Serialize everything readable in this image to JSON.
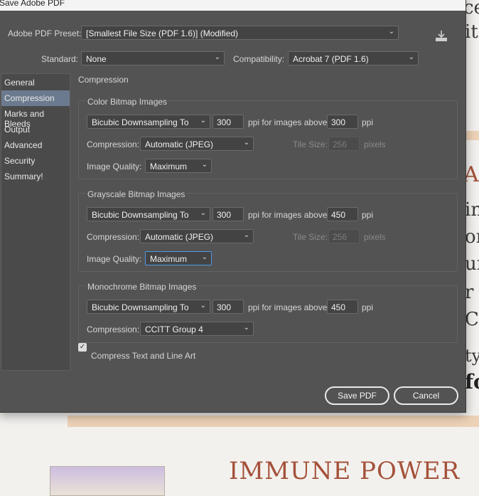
{
  "window": {
    "title": "Save Adobe PDF"
  },
  "preset": {
    "label": "Adobe PDF Preset:",
    "value": "[Smallest File Size (PDF 1.6)] (Modified)"
  },
  "standard": {
    "label": "Standard:",
    "value": "None"
  },
  "compatibility": {
    "label": "Compatibility:",
    "value": "Acrobat 7 (PDF 1.6)"
  },
  "sidebar": {
    "items": [
      {
        "label": "General"
      },
      {
        "label": "Compression"
      },
      {
        "label": "Marks and Bleeds"
      },
      {
        "label": "Output"
      },
      {
        "label": "Advanced"
      },
      {
        "label": "Security"
      },
      {
        "label": "Summary!"
      }
    ],
    "active_index": 1
  },
  "main": {
    "title": "Compression",
    "color": {
      "title": "Color Bitmap Images",
      "downsample": "Bicubic Downsampling To",
      "ppi": "300",
      "above_label": "ppi for images above",
      "above_value": "300",
      "ppi_unit": "ppi",
      "compression_label": "Compression:",
      "compression": "Automatic (JPEG)",
      "tile_label": "Tile Size:",
      "tile_value": "256",
      "tile_unit": "pixels",
      "quality_label": "Image Quality:",
      "quality": "Maximum"
    },
    "grayscale": {
      "title": "Grayscale Bitmap Images",
      "downsample": "Bicubic Downsampling To",
      "ppi": "300",
      "above_label": "ppi for images above",
      "above_value": "450",
      "ppi_unit": "ppi",
      "compression_label": "Compression:",
      "compression": "Automatic (JPEG)",
      "tile_label": "Tile Size:",
      "tile_value": "256",
      "tile_unit": "pixels",
      "quality_label": "Image Quality:",
      "quality": "Maximum"
    },
    "mono": {
      "title": "Monochrome Bitmap Images",
      "downsample": "Bicubic Downsampling To",
      "ppi": "300",
      "above_label": "ppi for images above",
      "above_value": "450",
      "ppi_unit": "ppi",
      "compression_label": "Compression:",
      "compression": "CCITT Group 4"
    },
    "compress_text": {
      "label": "Compress Text and Line Art",
      "checked": true
    }
  },
  "buttons": {
    "save": "Save PDF",
    "cancel": "Cancel"
  },
  "background_doc": {
    "frag_1": "ce",
    "frag_2": "it",
    "frag_3": "A",
    "frag_4": "in",
    "frag_5": "on",
    "frag_6": "ur",
    "frag_7": "r",
    "frag_8": "C",
    "frag_9": "ty",
    "frag_10": "fo",
    "headline": "IMMUNE POWER"
  },
  "colors": {
    "dialog_bg": "#535353",
    "accent": "#4d9be0",
    "headline": "#a4513a"
  }
}
